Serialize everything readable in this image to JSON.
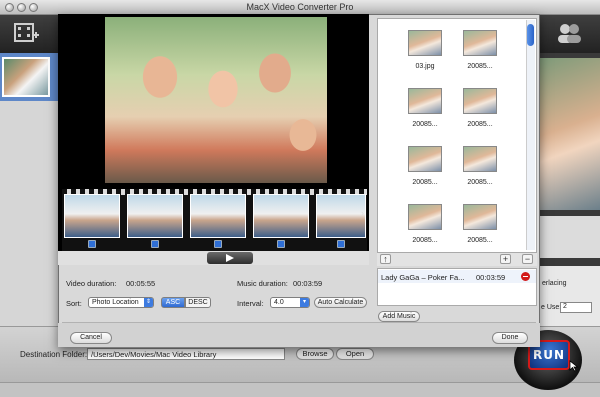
{
  "app": {
    "title": "MacX Video Converter Pro",
    "destination_label": "Destination Folder:",
    "destination_path": "/Users/Dev/Movies/Mac Video Library",
    "browse_label": "Browse",
    "open_label": "Open",
    "run_label": "RUN",
    "right_panel": {
      "interlacing_label": "erlacing",
      "core_use_label": "e Use:",
      "core_use_value": "2"
    }
  },
  "dialog": {
    "video_duration_label": "Video duration:",
    "video_duration": "00:05:55",
    "music_duration_label": "Music duration:",
    "music_duration": "00:03:59",
    "sort_label": "Sort:",
    "sort_value": "Photo Location",
    "sort_asc": "ASC",
    "sort_desc": "DESC",
    "interval_label": "Interval:",
    "interval_value": "4.0",
    "auto_calculate_label": "Auto Calculate",
    "add_music_label": "Add Music",
    "cancel_label": "Cancel",
    "done_label": "Done",
    "photos": [
      {
        "caption": "03.jpg"
      },
      {
        "caption": "20085..."
      },
      {
        "caption": "20085..."
      },
      {
        "caption": "20085..."
      },
      {
        "caption": "20085..."
      },
      {
        "caption": "20085..."
      },
      {
        "caption": "20085..."
      },
      {
        "caption": "20085..."
      }
    ],
    "music_items": [
      {
        "title": "Lady GaGa – Poker Fa...",
        "duration": "00:03:59"
      }
    ],
    "filmstrip_count": 5,
    "icons": {
      "play": "play-icon",
      "up": "move-up-icon",
      "add": "add-icon",
      "remove": "remove-icon"
    }
  }
}
